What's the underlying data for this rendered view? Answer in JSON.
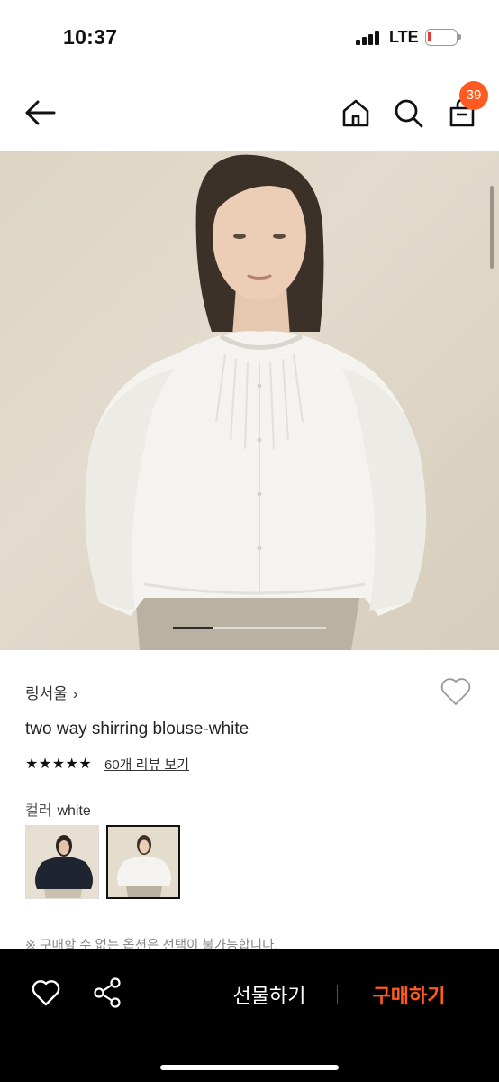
{
  "status_bar": {
    "time": "10:37",
    "network": "LTE",
    "battery_level": 0.1,
    "battery_color": "#e03a3a"
  },
  "nav": {
    "back_icon": "arrow-left-icon",
    "home_icon": "home-icon",
    "search_icon": "search-icon",
    "cart_icon": "shopping-bag-icon",
    "cart_count": "39",
    "badge_color": "#ff5a1f"
  },
  "gallery": {
    "image": "model-in-white-shirred-blouse",
    "active_page_fraction": 0.26
  },
  "product": {
    "brand": "링서울",
    "brand_chevron": "›",
    "name": "two way shirring blouse-white",
    "stars": "★★★★★",
    "rating": 5,
    "review_link": "60개 리뷰 보기"
  },
  "options": {
    "label": "컬러",
    "selected_value": "white",
    "swatches": [
      {
        "name": "black-blouse-swatch",
        "selected": false
      },
      {
        "name": "white-blouse-swatch",
        "selected": true
      }
    ]
  },
  "notice": "※ 구매할 수 없는 옵션은 선택이 불가능합니다.",
  "bottom_bar": {
    "wish_icon": "heart-outline-icon",
    "share_icon": "share-icon",
    "gift_label": "선물하기",
    "buy_label": "구매하기",
    "buy_color": "#ff5a1f"
  }
}
